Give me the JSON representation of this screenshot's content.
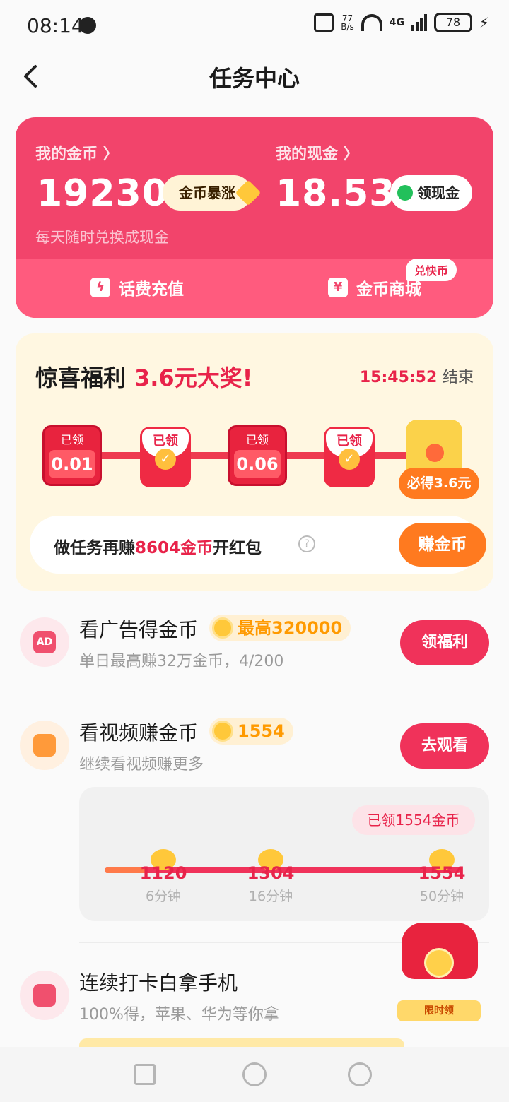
{
  "status_bar": {
    "time": "08:14",
    "speed_top": "77",
    "speed_bottom": "B/s",
    "network": "4G",
    "battery": "78"
  },
  "header": {
    "title": "任务中心"
  },
  "wallet": {
    "coins_label": "我的金币 〉",
    "coins_value": "19230",
    "coins_button": "金币暴涨",
    "coins_hint": "每天随时兑换成现金",
    "cash_label": "我的现金 〉",
    "cash_value": "18.53",
    "cash_button": "领现金",
    "recharge_label": "话费充值",
    "mall_label": "金币商城",
    "mall_badge": "兑快币"
  },
  "welfare": {
    "title": "惊喜福利",
    "title_highlight": "3.6元大奖!",
    "timer": "15:45:52",
    "timer_suffix": "结束",
    "claimed_label": "已领",
    "steps": [
      {
        "label": "已领",
        "amount": "0.01"
      },
      {
        "label": "已领"
      },
      {
        "label": "已领",
        "amount": "0.06"
      },
      {
        "label": "已领"
      }
    ],
    "final_badge": "必得3.6元",
    "task_prefix": "做任务再赚",
    "task_highlight": "8604金币",
    "task_suffix": "开红包",
    "earn_button": "赚金币"
  },
  "tasks": [
    {
      "title": "看广告得金币",
      "reward": "最高320000",
      "subtitle": "单日最高赚32万金币，4/200",
      "button": "领福利",
      "icon_text": "AD"
    },
    {
      "title": "看视频赚金币",
      "reward": "1554",
      "subtitle": "继续看视频赚更多",
      "button": "去观看"
    },
    {
      "title": "连续打卡白拿手机",
      "subtitle": "100%得，苹果、华为等你拿"
    }
  ],
  "video_progress": {
    "badge": "已领1554金币",
    "nodes": [
      {
        "value": "1120",
        "time": "6分钟"
      },
      {
        "value": "1304",
        "time": "16分钟"
      },
      {
        "value": "1554",
        "time": "50分钟"
      }
    ]
  },
  "floating_bag": {
    "label": "限时领"
  },
  "colors": {
    "primary_red": "#f2446b",
    "accent_orange": "#ff7a1f",
    "coin_gold": "#ffc83a"
  }
}
